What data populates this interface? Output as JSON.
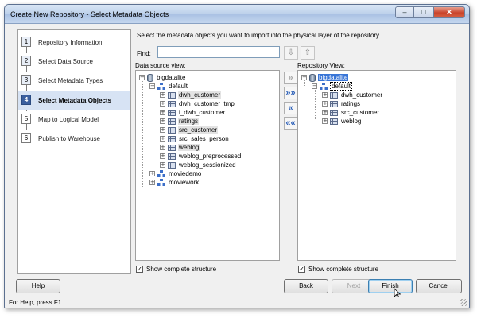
{
  "window": {
    "title": "Create New Repository - Select Metadata Objects",
    "controls": [
      "minimize-icon",
      "maximize-icon",
      "close-icon"
    ]
  },
  "steps": [
    {
      "num": "1",
      "label": "Repository Information",
      "state": "done"
    },
    {
      "num": "2",
      "label": "Select Data Source",
      "state": "done"
    },
    {
      "num": "3",
      "label": "Select Metadata Types",
      "state": "done"
    },
    {
      "num": "4",
      "label": "Select Metadata Objects",
      "state": "active"
    },
    {
      "num": "5",
      "label": "Map to Logical Model",
      "state": "pending"
    },
    {
      "num": "6",
      "label": "Publish to Warehouse",
      "state": "pending"
    }
  ],
  "main": {
    "instructions": "Select the metadata objects you want to import into the physical layer of the repository.",
    "find_label": "Find:",
    "find_value": "",
    "source_label": "Data source view:",
    "repo_label": "Repository View:"
  },
  "source_tree": {
    "root": "bigdatalite",
    "schema": "default",
    "tables": [
      {
        "name": "dwh_customer",
        "highlight": true
      },
      {
        "name": "dwh_customer_tmp",
        "highlight": false
      },
      {
        "name": "i_dwh_customer",
        "highlight": false
      },
      {
        "name": "ratings",
        "highlight": true
      },
      {
        "name": "src_customer",
        "highlight": true
      },
      {
        "name": "src_sales_person",
        "highlight": false
      },
      {
        "name": "weblog",
        "highlight": true
      },
      {
        "name": "weblog_preprocessed",
        "highlight": false
      },
      {
        "name": "weblog_sessionized",
        "highlight": false
      }
    ],
    "other_schemas": [
      "moviedemo",
      "moviework"
    ]
  },
  "repo_tree": {
    "root": "bigdatalite",
    "schema": "default",
    "tables": [
      "dwh_customer",
      "ratings",
      "src_customer",
      "weblog"
    ]
  },
  "checkboxes": {
    "source_label": "Show complete structure",
    "source_checked": true,
    "repo_label": "Show complete structure",
    "repo_checked": true
  },
  "buttons": {
    "help": "Help",
    "back": "Back",
    "next": "Next",
    "finish": "Finish",
    "cancel": "Cancel"
  },
  "status": "For Help, press F1",
  "colors": {
    "selection": "#3875d7",
    "active_step": "#3a5f9f",
    "arrow_icon": "#2b5fb8"
  }
}
